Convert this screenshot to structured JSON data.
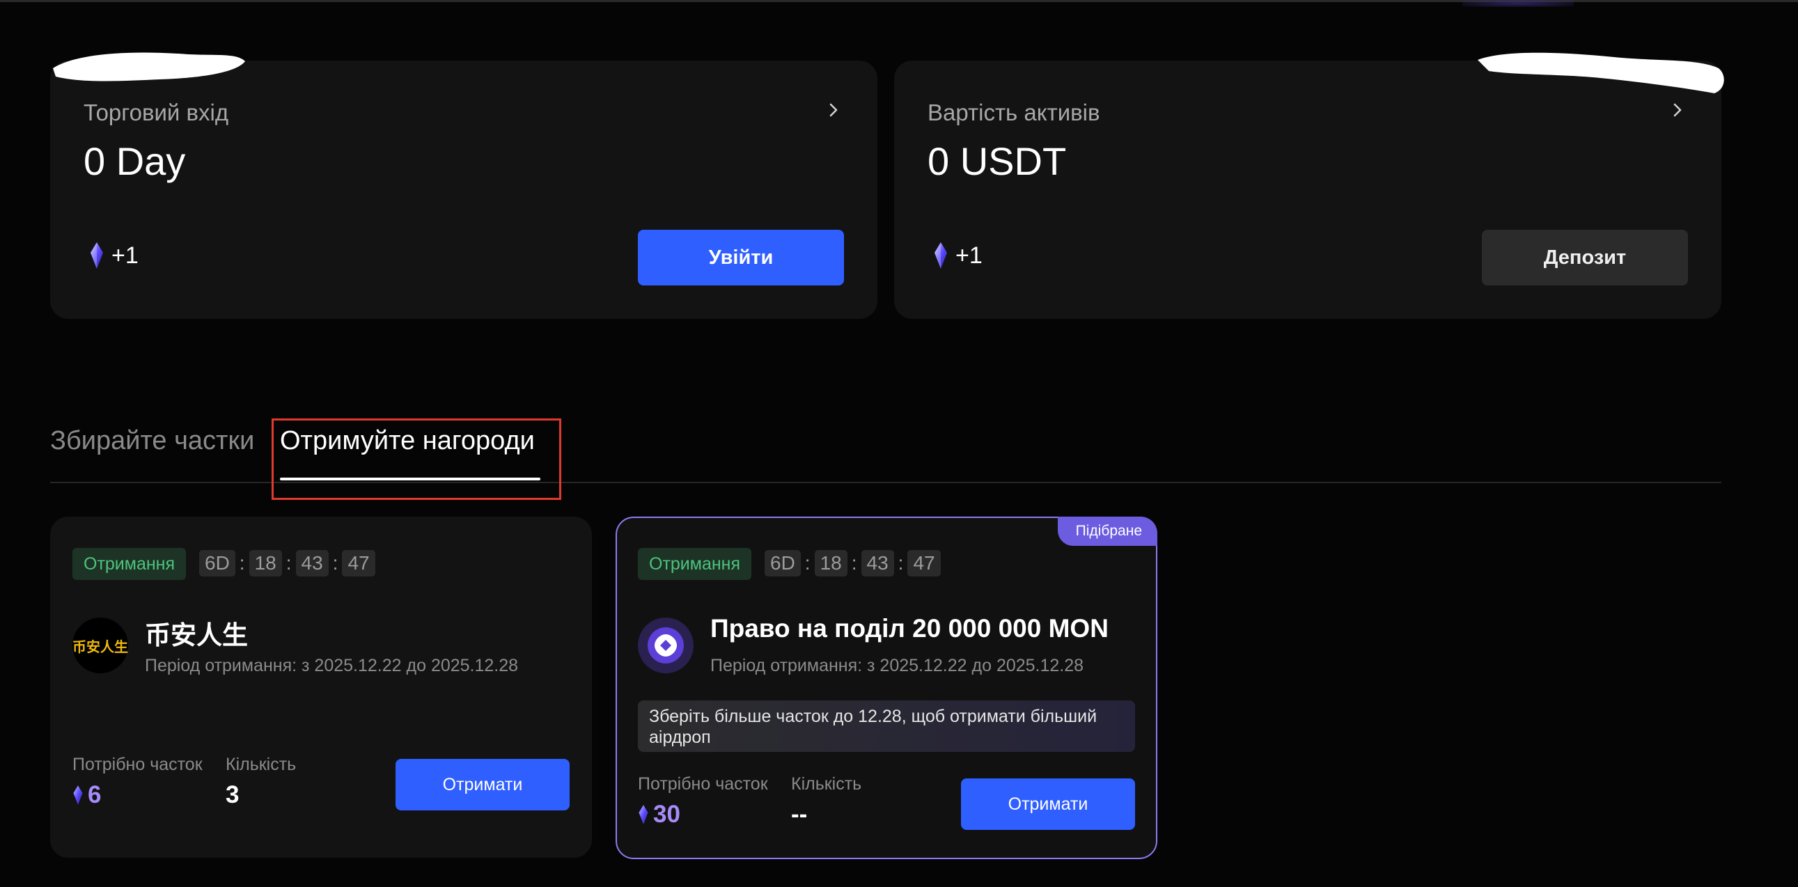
{
  "cards": [
    {
      "label": "Торговий вхід",
      "value": "0 Day",
      "gem_text": "+1",
      "button": "Увійти"
    },
    {
      "label": "Вартість активів",
      "value": "0 USDT",
      "gem_text": "+1",
      "button": "Депозит"
    }
  ],
  "tabs": {
    "inactive": "Збирайте частки",
    "active": "Отримуйте нагороди"
  },
  "rewards": [
    {
      "status": "Отримання",
      "timer": [
        "6D",
        "18",
        "43",
        "47"
      ],
      "logo_text": "币安人生",
      "title": "币安人生",
      "period": "Період отримання: з 2025.12.22 до 2025.12.28",
      "need_label": "Потрібно часток",
      "need_value": "6",
      "qty_label": "Кількість",
      "qty_value": "3",
      "button": "Отримати"
    },
    {
      "tag": "Підібране",
      "status": "Отримання",
      "timer": [
        "6D",
        "18",
        "43",
        "47"
      ],
      "title": "Право на поділ 20 000 000 MON",
      "period": "Період отримання: з 2025.12.22 до 2025.12.28",
      "info": "Зберіть більше часток до 12.28, щоб отримати більший аірдроп",
      "need_label": "Потрібно часток",
      "need_value": "30",
      "qty_label": "Кількість",
      "qty_value": "--",
      "button": "Отримати"
    }
  ],
  "colors": {
    "accent_blue": "#2f5fff",
    "gem_purple": "#a78bfa",
    "status_green": "#4dc37d",
    "highlight_red": "#e03a2f"
  }
}
